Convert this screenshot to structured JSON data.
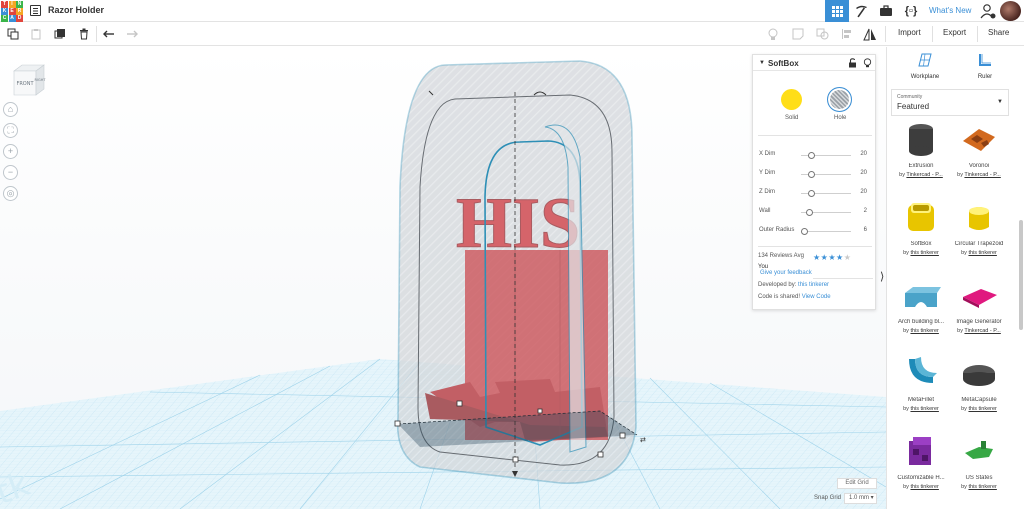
{
  "app": {
    "logo_letters": [
      "T",
      "I",
      "N",
      "K",
      "E",
      "R",
      "C",
      "A",
      "D"
    ],
    "logo_colors": [
      "#e2453c",
      "#f5a623",
      "#3ab54a",
      "#3a8fd6",
      "#e2453c",
      "#f5a623",
      "#3ab54a",
      "#3a8fd6",
      "#e2453c"
    ],
    "title": "Razor Holder",
    "whats_new": "What's New",
    "accent": "#3a8fd6"
  },
  "toolbar": {
    "import": "Import",
    "export": "Export",
    "share": "Share"
  },
  "workspace": {
    "viewcube_front": "FRONT",
    "viewcube_side": "RIGHT",
    "edit_grid": "Edit Grid",
    "snap_label": "Snap Grid",
    "snap_value": "1.0 mm ▾",
    "model_text": "HIS",
    "model_color": "#cc2229",
    "hole_color": "#5bb5d6",
    "grid_color": "#bfe6f5"
  },
  "inspector": {
    "shape_name": "SoftBox",
    "solid_label": "Solid",
    "hole_label": "Hole",
    "params": [
      {
        "name": "X Dim",
        "value": "20",
        "level": 0.2
      },
      {
        "name": "Y Dim",
        "value": "20",
        "level": 0.2
      },
      {
        "name": "Z Dim",
        "value": "20",
        "level": 0.2
      },
      {
        "name": "Wall",
        "value": "2",
        "level": 0.15
      },
      {
        "name": "Outer Radius",
        "value": "6",
        "level": 0.05
      }
    ],
    "reviews": "134 Reviews Avg",
    "rating": 4,
    "you": "You",
    "feedback": "Give your feedback",
    "developed_by": "Developed by:",
    "developer": "this tinkerer",
    "code_shared": "Code is shared!",
    "view_code": "View Code"
  },
  "rightpanel": {
    "workplane": "Workplane",
    "ruler": "Ruler",
    "category_small": "Community",
    "category": "Featured",
    "shapes": [
      {
        "name": "Extrusion",
        "by": "by",
        "author": "Tinkercad - P...",
        "icon": "extrusion-icon"
      },
      {
        "name": "Voronoi",
        "by": "by",
        "author": "Tinkercad - P...",
        "icon": "voronoi-icon"
      },
      {
        "name": "SoftBox",
        "by": "by",
        "author": "this tinkerer",
        "icon": "softbox-icon"
      },
      {
        "name": "Circular Trapezoid",
        "by": "by",
        "author": "this tinkerer",
        "icon": "trapezoid-icon"
      },
      {
        "name": "Arch building bl...",
        "by": "by",
        "author": "this tinkerer",
        "icon": "arch-icon"
      },
      {
        "name": "Image Generator",
        "by": "by",
        "author": "Tinkercad - P...",
        "icon": "image-generator-icon"
      },
      {
        "name": "MetaFillet",
        "by": "by",
        "author": "this tinkerer",
        "icon": "fillet-icon"
      },
      {
        "name": "MetaCapsule",
        "by": "by",
        "author": "this tinkerer",
        "icon": "capsule-icon"
      },
      {
        "name": "Customizable H...",
        "by": "by",
        "author": "this tinkerer",
        "icon": "customizable-icon"
      },
      {
        "name": "US States",
        "by": "by",
        "author": "this tinkerer",
        "icon": "us-states-icon"
      }
    ]
  }
}
